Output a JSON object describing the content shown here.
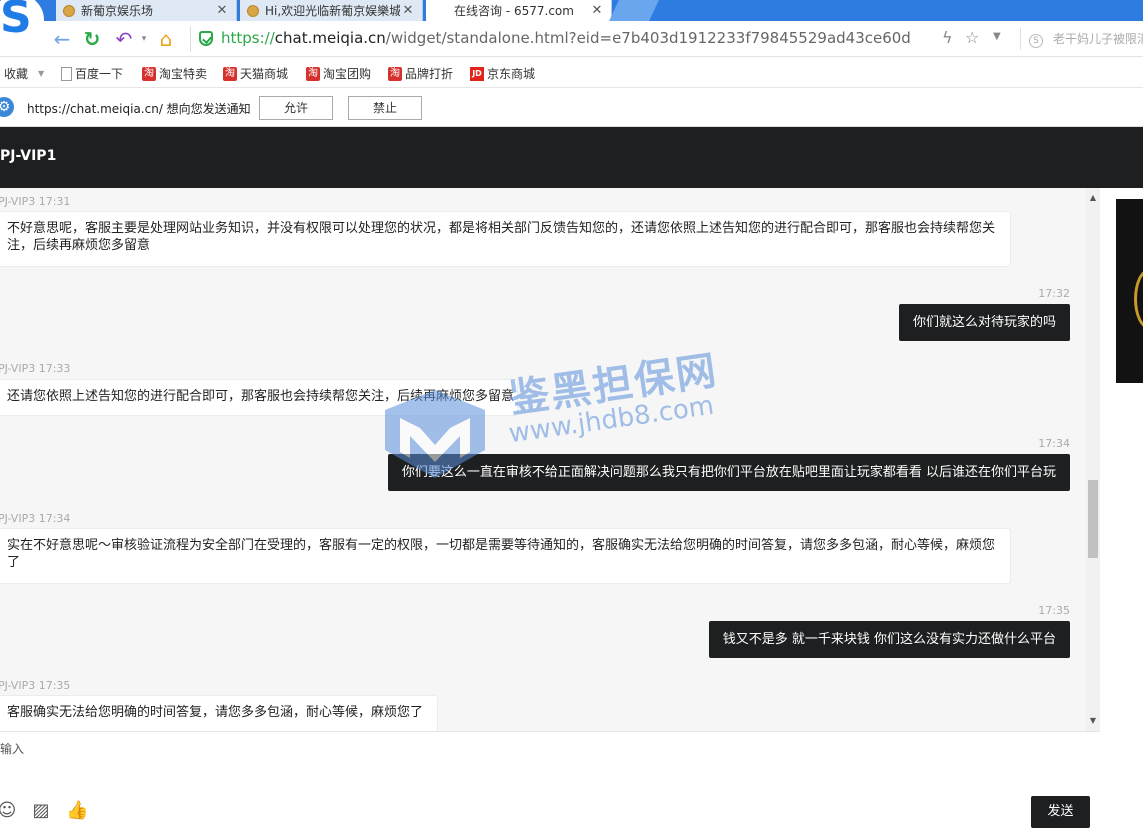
{
  "browser": {
    "tabs": [
      {
        "title": "新葡京娱乐场"
      },
      {
        "title": "Hi,欢迎光临新葡京娱樂城"
      },
      {
        "title": "在线咨询 - 6577.com"
      }
    ],
    "url": {
      "protocol": "https://",
      "host": "chat.meiqia.cn",
      "path": "/widget/standalone.html?eid=e7b403d1912233f79845529ad43ce60d"
    },
    "search_hint": "老干妈儿子被限消",
    "bookmarks": [
      {
        "label": "收藏",
        "icon": "star-icon"
      },
      {
        "label": "百度一下",
        "icon": "page-icon"
      },
      {
        "label": "淘宝特卖",
        "icon": "taobao-icon"
      },
      {
        "label": "天猫商城",
        "icon": "taobao-icon"
      },
      {
        "label": "淘宝团购",
        "icon": "taobao-icon"
      },
      {
        "label": "品牌打折",
        "icon": "taobao-icon"
      },
      {
        "label": "京东商城",
        "icon": "jd-icon"
      }
    ]
  },
  "notification": {
    "message": "https://chat.meiqia.cn/ 想向您发送通知",
    "allow_label": "允许",
    "block_label": "禁止"
  },
  "chat": {
    "agent_name": "PJ-VIP1",
    "messages": [
      {
        "from": "agent",
        "meta": "PJ-VIP3 17:31",
        "text": "不好意思呢，客服主要是处理网站业务知识，并没有权限可以处理您的状况，都是将相关部门反馈告知您的，还请您依照上述告知您的进行配合即可，那客服也会持续帮您关注，后续再麻烦您多留意"
      },
      {
        "from": "user",
        "meta": "17:32",
        "text": "你们就这么对待玩家的吗"
      },
      {
        "from": "agent",
        "meta": "PJ-VIP3 17:33",
        "text": "还请您依照上述告知您的进行配合即可，那客服也会持续帮您关注，后续再麻烦您多留意"
      },
      {
        "from": "user",
        "meta": "17:34",
        "text": "你们要这么一直在审核不给正面解决问题那么我只有把你们平台放在贴吧里面让玩家都看看 以后谁还在你们平台玩"
      },
      {
        "from": "agent",
        "meta": "PJ-VIP3 17:34",
        "text": "实在不好意思呢～审核验证流程为安全部门在受理的，客服有一定的权限，一切都是需要等待通知的，客服确实无法给您明确的时间答复，请您多多包涵，耐心等候，麻烦您了"
      },
      {
        "from": "user",
        "meta": "17:35",
        "text": "钱又不是多 就一千来块钱 你们这么没有实力还做什么平台"
      },
      {
        "from": "agent",
        "meta": "PJ-VIP3 17:35",
        "text": "客服确实无法给您明确的时间答复，请您多多包涵，耐心等候，麻烦您了"
      }
    ],
    "input_placeholder": "输入",
    "send_label": "发送"
  },
  "watermark": {
    "title": "鉴黑担保网",
    "url": "www.jhdb8.com"
  },
  "colors": {
    "tabbar": "#2f7ce0",
    "header": "#1d1f21",
    "bubble_out": "#1e1f20",
    "secure_green": "#2aa948"
  }
}
